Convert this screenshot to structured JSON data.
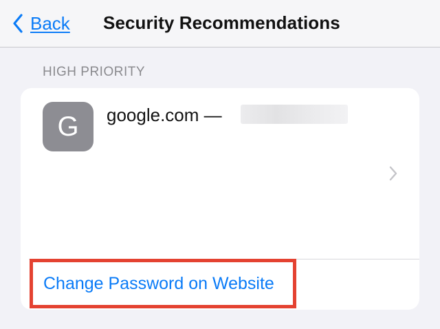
{
  "nav": {
    "back_label": "Back",
    "title": "Security Recommendations"
  },
  "section": {
    "header": "HIGH PRIORITY"
  },
  "item": {
    "site_initial": "G",
    "site_label": "google.com —"
  },
  "action": {
    "label": "Change Password on Website"
  },
  "colors": {
    "accent": "#0a7bf7",
    "highlight": "#e44231",
    "background": "#f2f2f7"
  },
  "icons": {
    "back": "chevron-left-icon",
    "row_disclosure": "chevron-right-icon"
  }
}
